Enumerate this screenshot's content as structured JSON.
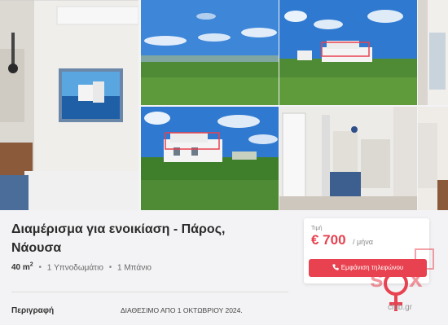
{
  "listing": {
    "title": "Διαμέρισμα για ενοικίαση - Πάρος, Νάουσα",
    "features": {
      "area_value": "40 m",
      "area_sup": "2",
      "bedrooms": "1 Υπνοδωμάτιο",
      "bathrooms": "1 Μπάνιο",
      "separator": "•"
    }
  },
  "price_card": {
    "label": "Τιμή",
    "value": "€ 700",
    "unit": "/ μήνα",
    "button_label": "Εμφάνιση τηλεφώνου"
  },
  "description": {
    "heading": "Περιγραφή",
    "text": "ΔΙΑΘΕΣΙΜΟ ΑΠΟ 1 ΟΚΤΩΒΡΙΟΥ 2024."
  },
  "watermark": {
    "text": "club.gr"
  },
  "colors": {
    "accent": "#e8414f",
    "sky": "#3b82d6",
    "field": "#4f8a34"
  },
  "icons": [
    "phone-icon",
    "female-symbol-icon"
  ]
}
